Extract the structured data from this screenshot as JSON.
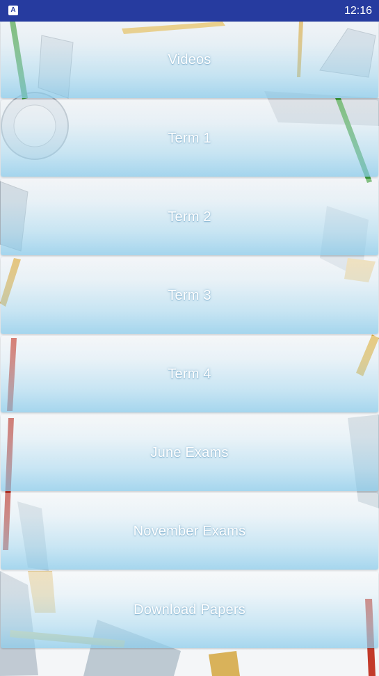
{
  "status_bar": {
    "time": "12:16",
    "app_icon_glyph": "A",
    "background_color": "#263b9f"
  },
  "menu": {
    "items": [
      {
        "label": "Videos"
      },
      {
        "label": "Term 1"
      },
      {
        "label": "Term 2"
      },
      {
        "label": "Term 3"
      },
      {
        "label": "Term 4"
      },
      {
        "label": "June Exams"
      },
      {
        "label": "November Exams"
      },
      {
        "label": "Download Papers"
      }
    ],
    "item_gradient_bottom_color": "#8cccEB"
  },
  "background": {
    "decor_icons": [
      "pencil-icon",
      "ruler-icon",
      "protractor-icon",
      "set-square-icon",
      "eraser-icon"
    ]
  }
}
